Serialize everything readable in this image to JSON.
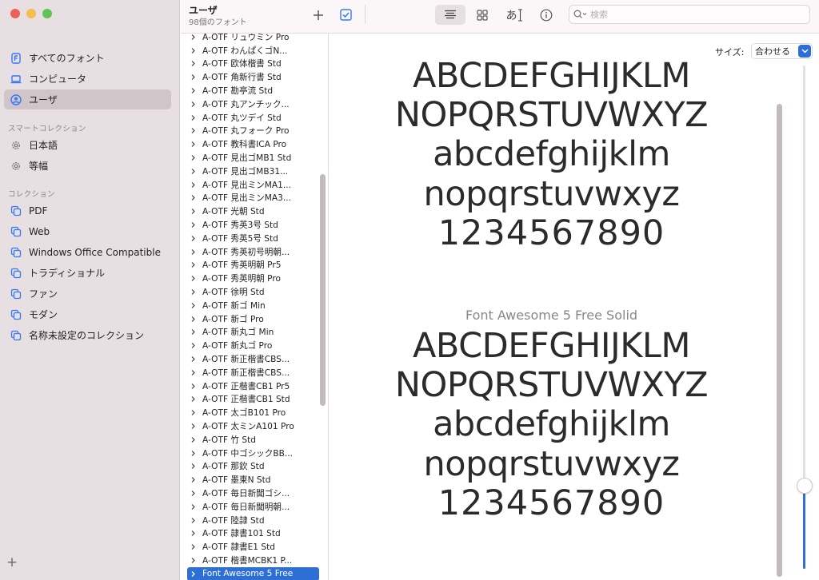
{
  "window": {
    "title": "ユーザ",
    "subtitle": "98個のフォント"
  },
  "sidebar": {
    "library_items": [
      {
        "label": "すべてのフォント",
        "icon": "font-book-icon"
      },
      {
        "label": "コンピュータ",
        "icon": "laptop-icon"
      },
      {
        "label": "ユーザ",
        "icon": "user-circle-icon",
        "selected": true
      }
    ],
    "smart_collections_heading": "スマートコレクション",
    "smart_collections": [
      {
        "label": "日本語",
        "icon": "gear-icon"
      },
      {
        "label": "等幅",
        "icon": "gear-icon"
      }
    ],
    "collections_heading": "コレクション",
    "collections": [
      {
        "label": "PDF",
        "icon": "collection-icon"
      },
      {
        "label": "Web",
        "icon": "collection-icon"
      },
      {
        "label": "Windows Office Compatible",
        "icon": "collection-icon"
      },
      {
        "label": "トラディショナル",
        "icon": "collection-icon"
      },
      {
        "label": "ファン",
        "icon": "collection-icon"
      },
      {
        "label": "モダン",
        "icon": "collection-icon"
      },
      {
        "label": "名称未設定のコレクション",
        "icon": "collection-icon"
      }
    ],
    "add_label": "+"
  },
  "toolbar": {
    "search_placeholder": "検索",
    "add_icon": "plus-icon",
    "validate_icon": "checkbox-icon",
    "sample_view_icon": "lines-icon",
    "grid_view_icon": "grid-icon",
    "character_view_icon": "char-view-icon",
    "character_view_label": "あ",
    "info_icon": "info-icon"
  },
  "font_list": {
    "items": [
      "A-OTF リュウミン Pro",
      "A-OTF わんぱくゴN...",
      "A-OTF 欧体楷書 Std",
      "A-OTF 角新行書 Std",
      "A-OTF 勘亭流 Std",
      "A-OTF 丸アンチック...",
      "A-OTF 丸ツデイ Std",
      "A-OTF 丸フォーク Pro",
      "A-OTF 教科書ICA Pro",
      "A-OTF 見出ゴMB1 Std",
      "A-OTF 見出ゴMB31...",
      "A-OTF 見出ミンMA1...",
      "A-OTF 見出ミンMA3...",
      "A-OTF 光朝 Std",
      "A-OTF 秀英3号 Std",
      "A-OTF 秀英5号 Std",
      "A-OTF 秀英初号明朝...",
      "A-OTF 秀英明朝 Pr5",
      "A-OTF 秀英明朝 Pro",
      "A-OTF 徐明 Std",
      "A-OTF 新ゴ Min",
      "A-OTF 新ゴ Pro",
      "A-OTF 新丸ゴ Min",
      "A-OTF 新丸ゴ Pro",
      "A-OTF 新正楷書CBS...",
      "A-OTF 新正楷書CBS...",
      "A-OTF 正楷書CB1 Pr5",
      "A-OTF 正楷書CB1 Std",
      "A-OTF 太ゴB101 Pro",
      "A-OTF 太ミンA101 Pro",
      "A-OTF 竹 Std",
      "A-OTF 中ゴシックBB...",
      "A-OTF 那欽 Std",
      "A-OTF 墨東N Std",
      "A-OTF 毎日新聞ゴシ...",
      "A-OTF 毎日新聞明朝...",
      "A-OTF 陸隷 Std",
      "A-OTF 隷書101 Std",
      "A-OTF 隷書E1 Std",
      "A-OTF 楷書MCBK1 P...",
      "Font Awesome 5 Free"
    ],
    "selected_index": 40
  },
  "preview": {
    "size_label": "サイズ:",
    "size_value": "合わせる",
    "font_name": "Font Awesome 5 Free Solid",
    "uppercase_1": "ABCDEFGHIJKLM",
    "uppercase_2": "NOPQRSTUVWXYZ",
    "lowercase_1": "abcdefghijklm",
    "lowercase_2": "nopqrstuvwxyz",
    "digits": "1234567890",
    "size_slider_percent": 15
  },
  "colors": {
    "accent": "#2e6fd6",
    "sidebar_bg": "#e8dfe2",
    "selected_sidebar": "#d0c6c9"
  }
}
